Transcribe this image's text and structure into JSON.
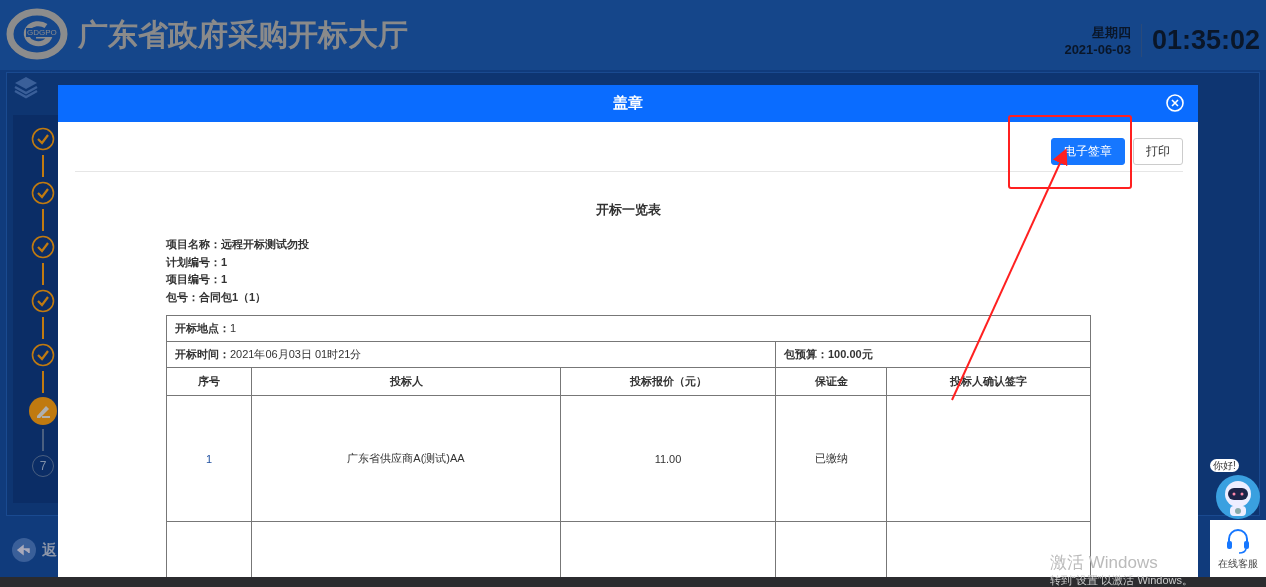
{
  "header": {
    "title": "广东省政府采购开标大厅",
    "logo_text": "GDGPO",
    "weekday": "星期四",
    "date": "2021-06-03",
    "time": "01:35:02"
  },
  "steps": [
    {
      "kind": "done"
    },
    {
      "kind": "done"
    },
    {
      "kind": "done"
    },
    {
      "kind": "done"
    },
    {
      "kind": "done"
    },
    {
      "kind": "current"
    },
    {
      "kind": "pending",
      "number": "7"
    }
  ],
  "back_button": {
    "label": "返"
  },
  "dialog": {
    "title": "盖章",
    "buttons": [
      {
        "label": "电子签章",
        "kind": "primary"
      },
      {
        "label": "打印",
        "kind": "default"
      }
    ],
    "document": {
      "title": "开标一览表",
      "info_lines": [
        "项目名称：远程开标测试勿投",
        "计划编号：1",
        "项目编号：1",
        "包号：合同包1（1）"
      ],
      "location": "**开标地点：**1",
      "time": "**开标时间：**2021年06月03日 01时21分",
      "budget": "包预算：100.00元",
      "columns": [
        "序号",
        "投标人",
        "投标报价（元）",
        "保证金",
        "投标人确认签字"
      ],
      "rows": [
        {
          "cells": [
            "1",
            "广东省供应商A(测试)AA",
            "11.00",
            "已缴纳"
          ]
        }
      ]
    }
  },
  "chat_widget": {
    "greeting": "你好!",
    "label": "在线客服"
  },
  "os_notice": {
    "title": "激活 Windows",
    "hint": "转到“设置”以激活 Windows。"
  }
}
